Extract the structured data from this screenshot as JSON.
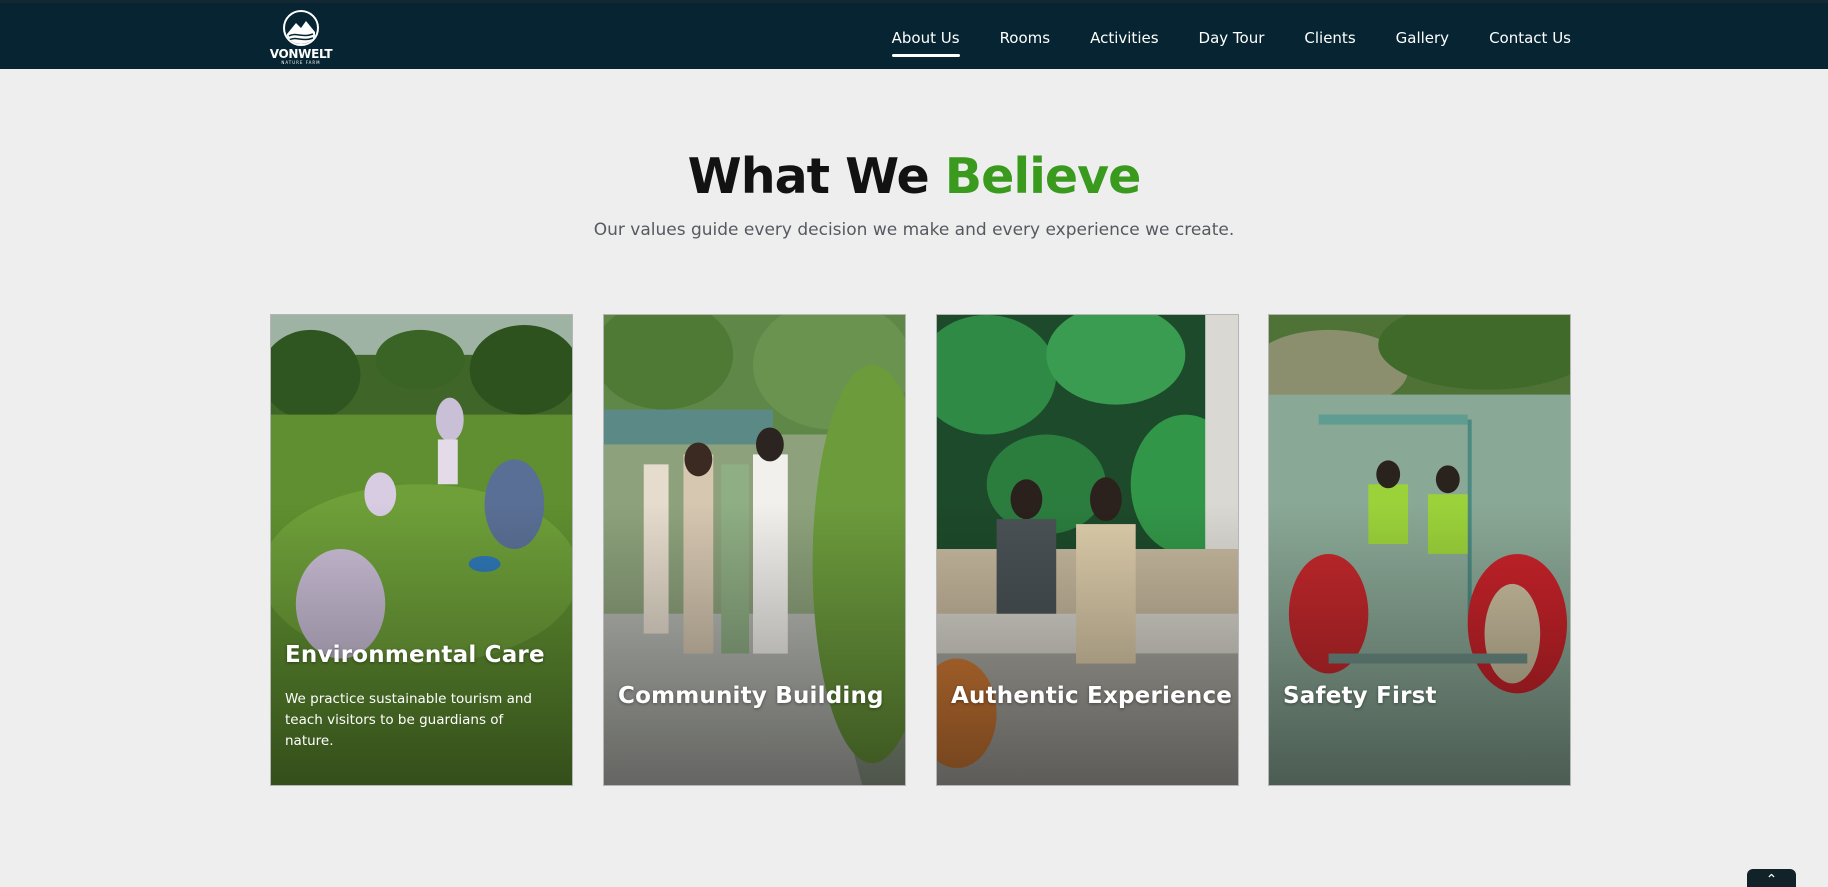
{
  "brand": {
    "name": "VONWELT",
    "tagline": "NATURE FARM"
  },
  "nav": {
    "items": [
      {
        "label": "About Us",
        "active": true
      },
      {
        "label": "Rooms"
      },
      {
        "label": "Activities"
      },
      {
        "label": "Day Tour"
      },
      {
        "label": "Clients"
      },
      {
        "label": "Gallery"
      },
      {
        "label": "Contact Us"
      }
    ]
  },
  "section": {
    "title_main": "What We",
    "title_accent": "Believe",
    "subtitle": "Our values guide every decision we make and every experience we create."
  },
  "cards": [
    {
      "title": "Environmental Care",
      "description": "We practice sustainable tourism and teach visitors to be guardians of nature."
    },
    {
      "title": "Community Building"
    },
    {
      "title": "Authentic Experience"
    },
    {
      "title": "Safety First"
    }
  ],
  "scroll_top": {
    "icon": "chevron-up-icon"
  },
  "colors": {
    "header": "#062431",
    "accent": "#3a9a1d",
    "background": "#eeeeee"
  }
}
